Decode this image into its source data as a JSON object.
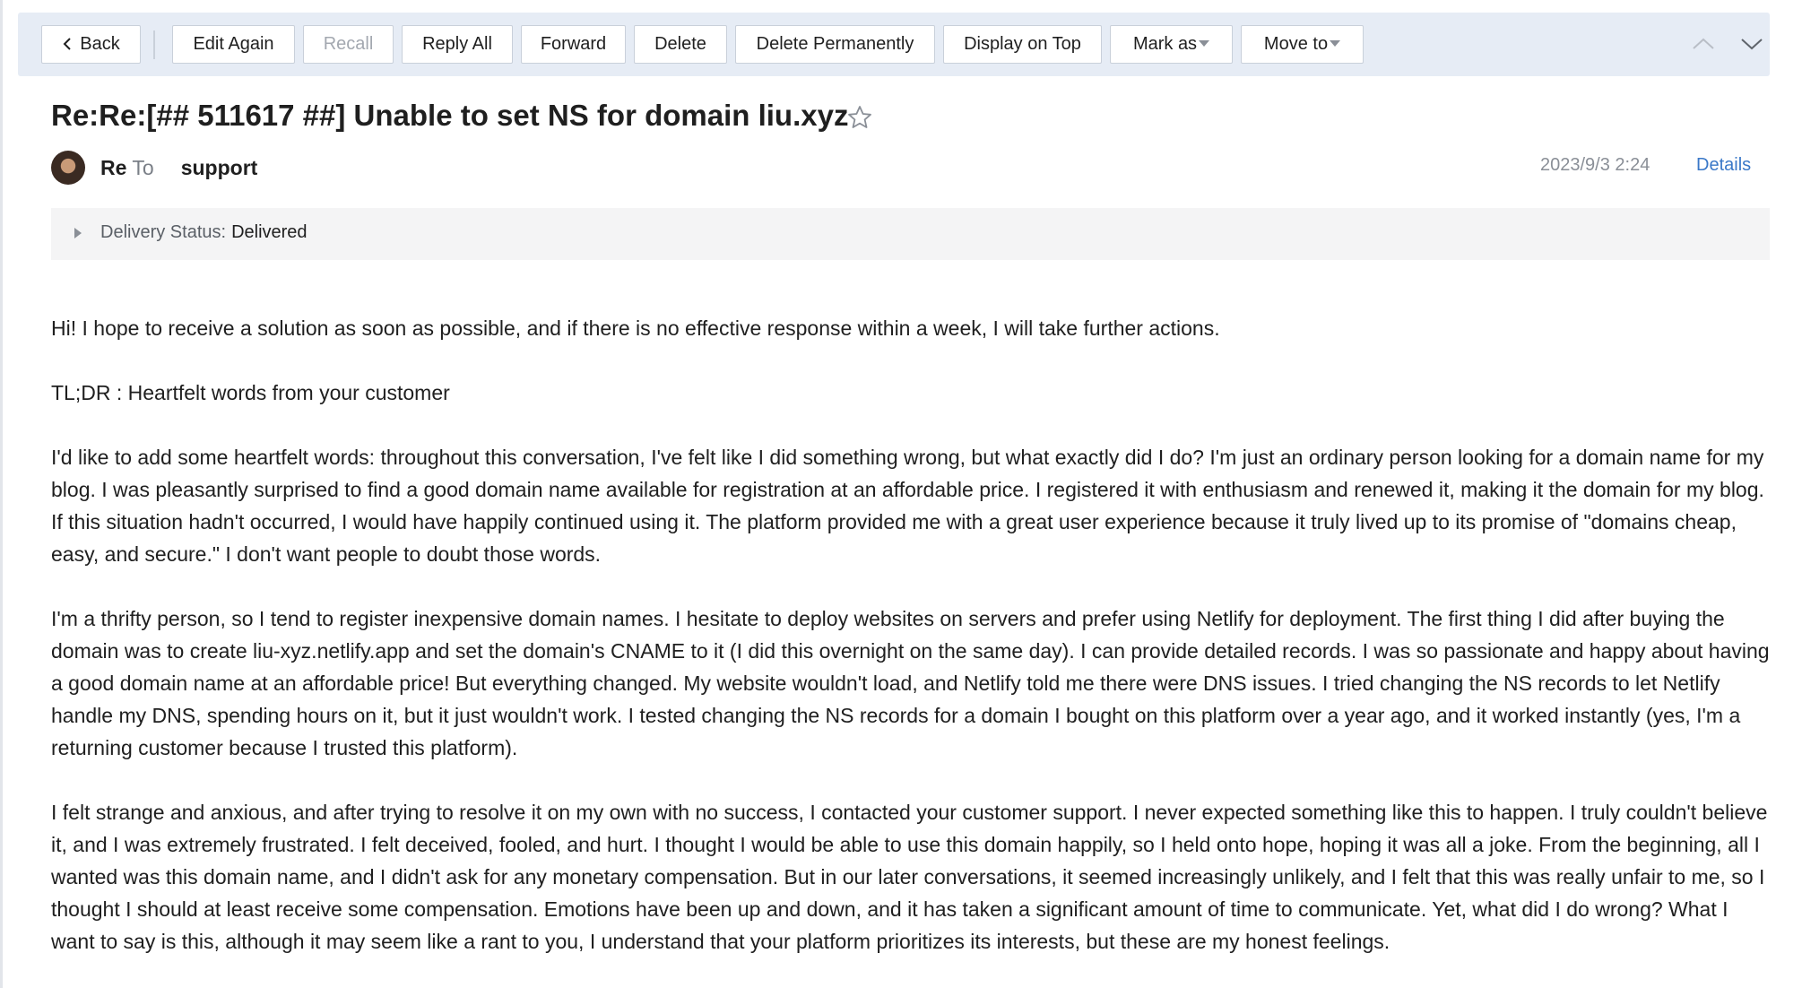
{
  "toolbar": {
    "back": "Back",
    "edit_again": "Edit Again",
    "recall": "Recall",
    "reply_all": "Reply All",
    "forward": "Forward",
    "delete": "Delete",
    "delete_permanently": "Delete Permanently",
    "display_on_top": "Display on Top",
    "mark_as": "Mark as",
    "move_to": "Move to",
    "icons": [
      "chevron-left-icon",
      "chevron-up-icon",
      "chevron-down-icon",
      "caret-down-icon"
    ]
  },
  "email": {
    "subject": "Re:Re:[## 511617 ##] Unable to set NS for domain liu.xyz",
    "sender": "Re",
    "to_label": "To",
    "recipient": "support",
    "date": "2023/9/3 2:24",
    "details_link": "Details",
    "delivery_status_label": "Delivery Status:",
    "delivery_status_value": "Delivered",
    "paragraphs": [
      "Hi! I hope to receive a solution as soon as possible, and if there is no effective response within a week, I will take further actions.",
      "TL;DR : Heartfelt words from your customer",
      "I'd like to add some heartfelt words: throughout this conversation, I've felt like I did something wrong, but what exactly did I do? I'm just an ordinary person looking for a domain name for my blog. I was pleasantly surprised to find a good domain name available for registration at an affordable price. I registered it with enthusiasm and renewed it, making it the domain for my blog. If this situation hadn't occurred, I would have happily continued using it. The platform provided me with a great user experience because it truly lived up to its promise of \"domains cheap, easy, and secure.\" I don't want people to doubt those words.",
      "I'm a thrifty person, so I tend to register inexpensive domain names. I hesitate to deploy websites on servers and prefer using Netlify for deployment. The first thing I did after buying the domain was to create liu-xyz.netlify.app and set the domain's CNAME to it (I did this overnight on the same day). I can provide detailed records. I was so passionate and happy about having a good domain name at an affordable price! But everything changed. My website wouldn't load, and Netlify told me there were DNS issues. I tried changing the NS records to let Netlify handle my DNS, spending hours on it, but it just wouldn't work. I tested changing the NS records for a domain I bought on this platform over a year ago, and it worked instantly (yes, I'm a returning customer because I trusted this platform).",
      "I felt strange and anxious, and after trying to resolve it on my own with no success, I contacted your customer support. I never expected something like this to happen. I truly couldn't believe it, and I was extremely frustrated. I felt deceived, fooled, and hurt. I thought I would be able to use this domain happily, so I held onto hope, hoping it was all a joke. From the beginning, all I wanted was this domain name, and I didn't ask for any monetary compensation. But in our later conversations, it seemed increasingly unlikely, and I felt that this was really unfair to me, so I thought I should at least receive some compensation. Emotions have been up and down, and it has taken a significant amount of time to communicate. Yet, what did I do wrong? What I want to say is this, although it may seem like a rant to you, I understand that your platform prioritizes its interests, but these are my honest feelings."
    ]
  },
  "colors": {
    "toolbar_bg": "#e6ecf5",
    "link": "#3a78c8",
    "muted": "#8a8f97",
    "status_bg": "#f4f4f5"
  }
}
